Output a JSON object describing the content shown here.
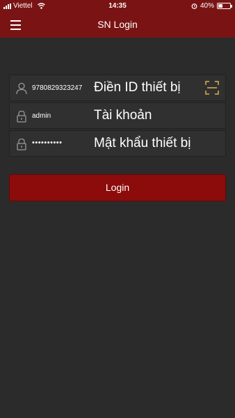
{
  "status_bar": {
    "carrier": "Viettel",
    "time": "14:35",
    "battery": "40%",
    "battery_level": 0.4
  },
  "header": {
    "title": "SN Login"
  },
  "form": {
    "device_id": {
      "value": "9780829323247",
      "placeholder": "Điền ID thiết bị"
    },
    "account": {
      "value": "admin",
      "placeholder": "Tài khoản"
    },
    "password": {
      "value": "••••••••••",
      "placeholder": "Mật khẩu thiết bị"
    }
  },
  "login_label": "Login",
  "icons": {
    "menu": "menu-icon",
    "device": "user-icon",
    "account": "lock-icon",
    "password": "lock-icon",
    "scan": "scan-icon"
  },
  "colors": {
    "header": "#7a1414",
    "background": "#2b2b2b",
    "button": "#8c0b0b",
    "scan_icon": "#d9b24a"
  }
}
